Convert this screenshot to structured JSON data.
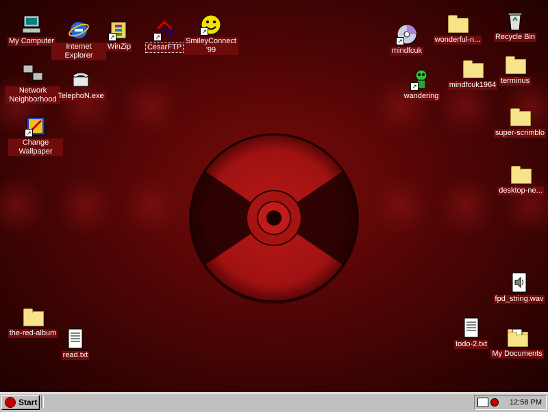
{
  "desktop": {
    "icons": [
      {
        "key": "my_computer",
        "label": "My Computer"
      },
      {
        "key": "internet_explorer",
        "label": "Internet Explorer"
      },
      {
        "key": "winzip",
        "label": "WinZip"
      },
      {
        "key": "cesarftp",
        "label": "CesarFTP"
      },
      {
        "key": "smileyconnect",
        "label": "SmileyConnect '99"
      },
      {
        "key": "network_neighborhood",
        "label": "Network Neighborhood"
      },
      {
        "key": "telephon",
        "label": "TelephoN.exe"
      },
      {
        "key": "change_wallpaper",
        "label": "Change Wallpaper"
      },
      {
        "key": "the_red_album",
        "label": "the-red-album"
      },
      {
        "key": "read_txt",
        "label": "read.txt"
      },
      {
        "key": "mindfcuk",
        "label": "mindfcuk"
      },
      {
        "key": "wonderful",
        "label": "wonderful-n..."
      },
      {
        "key": "recycle_bin",
        "label": "Recycle Bin"
      },
      {
        "key": "wandering",
        "label": "wandering"
      },
      {
        "key": "mindfcuk1964",
        "label": "mindfcuk1964"
      },
      {
        "key": "terminus",
        "label": "terminus"
      },
      {
        "key": "super_scrimblo",
        "label": "super-scrimblo"
      },
      {
        "key": "desktop_ne",
        "label": "desktop-ne..."
      },
      {
        "key": "fpd_string",
        "label": "fpd_string.wav"
      },
      {
        "key": "todo2",
        "label": "todo-2.txt"
      },
      {
        "key": "my_documents",
        "label": "My Documents"
      }
    ]
  },
  "taskbar": {
    "start_label": "Start",
    "clock": "12:58 PM"
  },
  "colors": {
    "desktop_bg": "#5a0606",
    "taskbar": "#c0c0c0",
    "label_bg": "#6e0b0b"
  }
}
